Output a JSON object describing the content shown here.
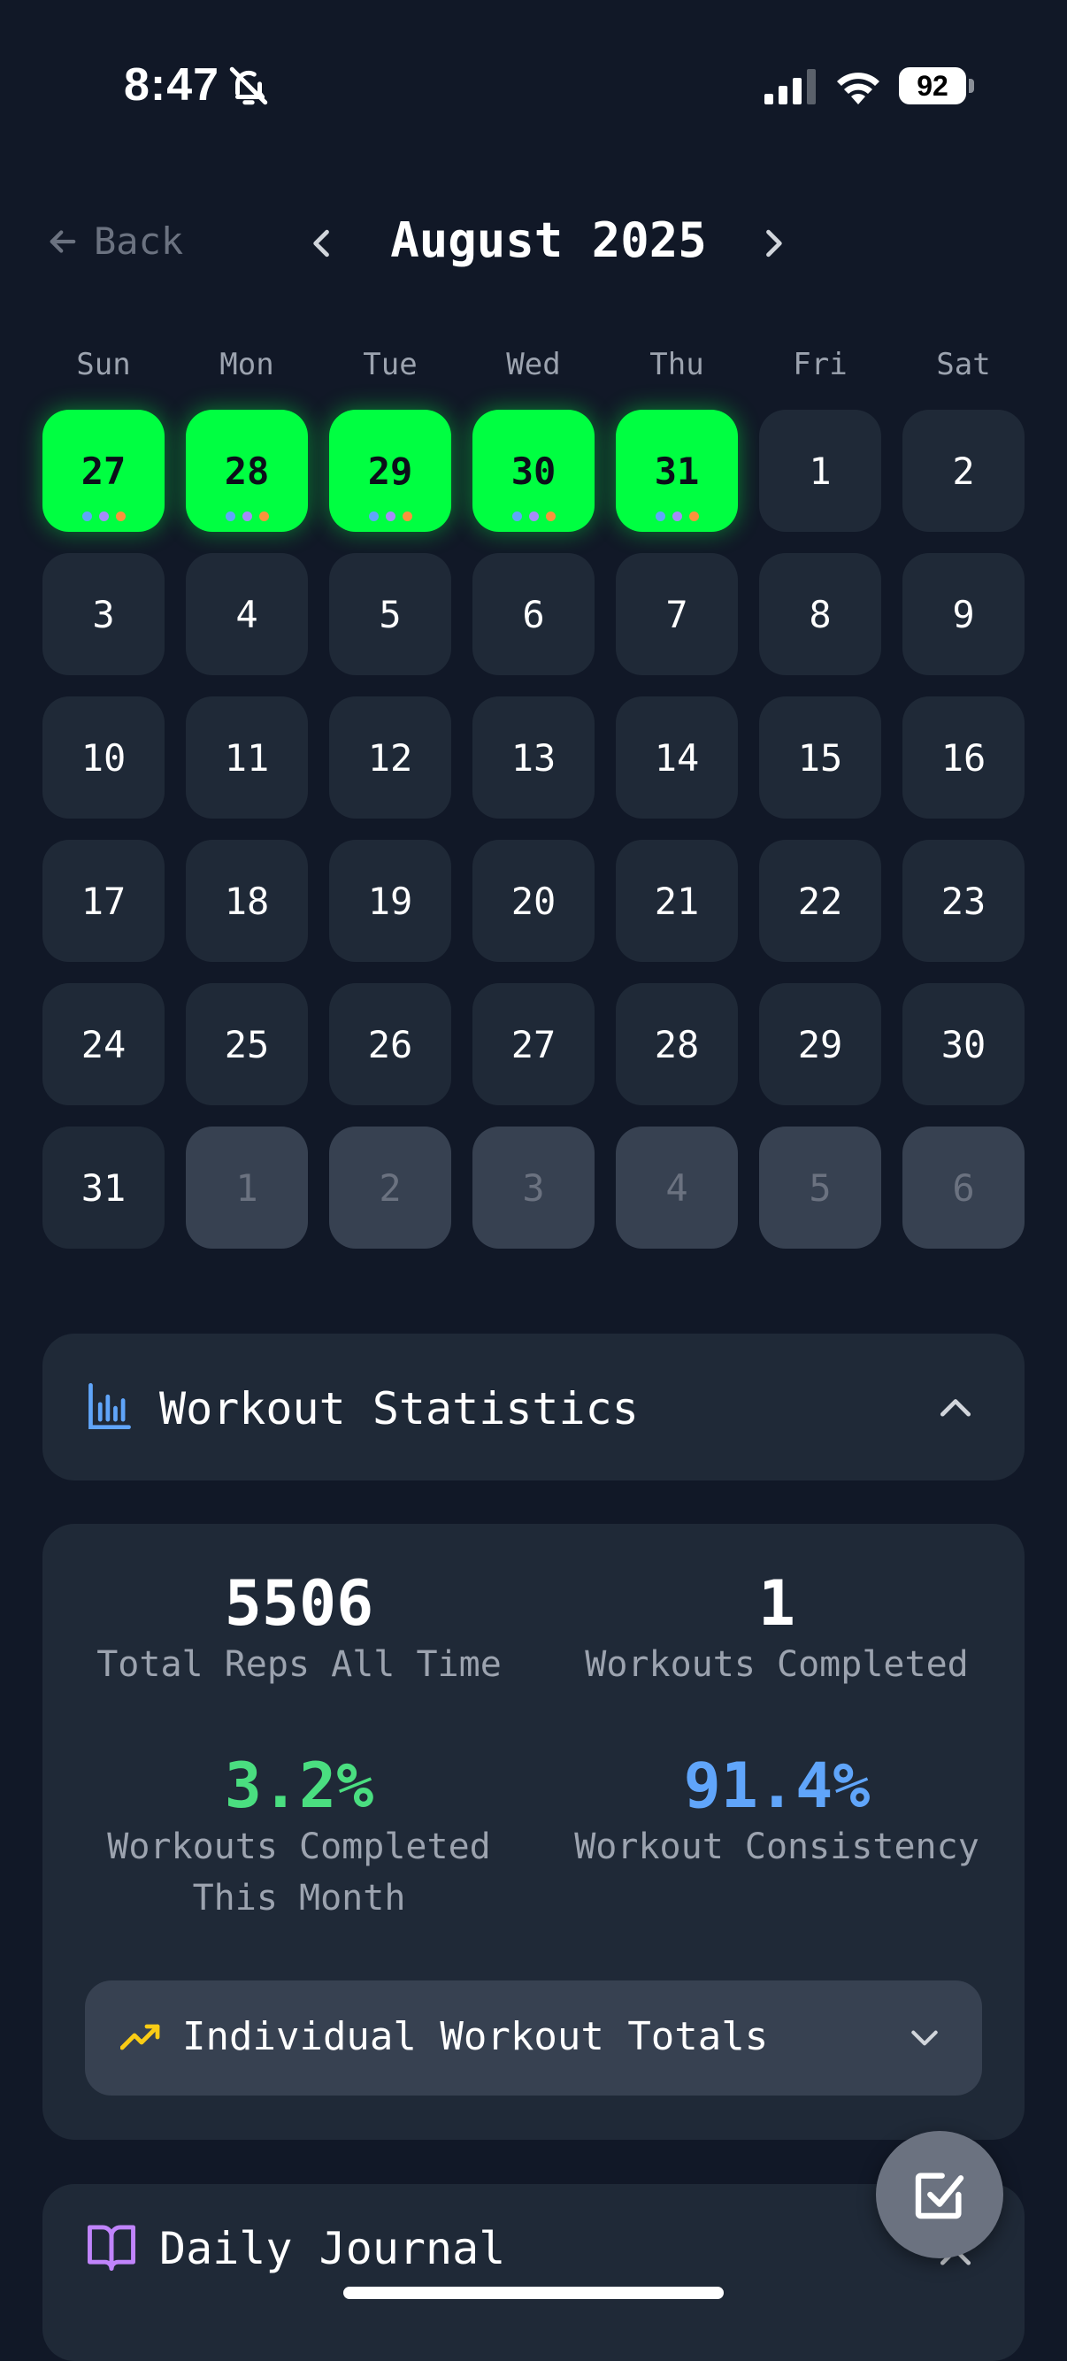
{
  "status_bar": {
    "time": "8:47",
    "battery": "92"
  },
  "nav": {
    "back_label": "Back",
    "month_title": "August 2025"
  },
  "calendar": {
    "weekdays": [
      "Sun",
      "Mon",
      "Tue",
      "Wed",
      "Thu",
      "Fri",
      "Sat"
    ],
    "weeks": [
      [
        {
          "d": "27",
          "s": "done"
        },
        {
          "d": "28",
          "s": "done"
        },
        {
          "d": "29",
          "s": "done"
        },
        {
          "d": "30",
          "s": "done"
        },
        {
          "d": "31",
          "s": "done"
        },
        {
          "d": "1",
          "s": "normal"
        },
        {
          "d": "2",
          "s": "normal"
        }
      ],
      [
        {
          "d": "3",
          "s": "normal"
        },
        {
          "d": "4",
          "s": "normal"
        },
        {
          "d": "5",
          "s": "normal"
        },
        {
          "d": "6",
          "s": "normal"
        },
        {
          "d": "7",
          "s": "normal"
        },
        {
          "d": "8",
          "s": "normal"
        },
        {
          "d": "9",
          "s": "normal"
        }
      ],
      [
        {
          "d": "10",
          "s": "normal"
        },
        {
          "d": "11",
          "s": "normal"
        },
        {
          "d": "12",
          "s": "normal"
        },
        {
          "d": "13",
          "s": "normal"
        },
        {
          "d": "14",
          "s": "normal"
        },
        {
          "d": "15",
          "s": "normal"
        },
        {
          "d": "16",
          "s": "normal"
        }
      ],
      [
        {
          "d": "17",
          "s": "normal"
        },
        {
          "d": "18",
          "s": "normal"
        },
        {
          "d": "19",
          "s": "normal"
        },
        {
          "d": "20",
          "s": "normal"
        },
        {
          "d": "21",
          "s": "normal"
        },
        {
          "d": "22",
          "s": "normal"
        },
        {
          "d": "23",
          "s": "normal"
        }
      ],
      [
        {
          "d": "24",
          "s": "normal"
        },
        {
          "d": "25",
          "s": "normal"
        },
        {
          "d": "26",
          "s": "normal"
        },
        {
          "d": "27",
          "s": "normal"
        },
        {
          "d": "28",
          "s": "normal"
        },
        {
          "d": "29",
          "s": "normal"
        },
        {
          "d": "30",
          "s": "normal"
        }
      ],
      [
        {
          "d": "31",
          "s": "normal"
        },
        {
          "d": "1",
          "s": "other"
        },
        {
          "d": "2",
          "s": "other"
        },
        {
          "d": "3",
          "s": "other"
        },
        {
          "d": "4",
          "s": "other"
        },
        {
          "d": "5",
          "s": "other"
        },
        {
          "d": "6",
          "s": "other"
        }
      ]
    ],
    "dot_colors": [
      "#60a5fa",
      "#a78bfa",
      "#fb923c"
    ]
  },
  "stats": {
    "header_title": "Workout Statistics",
    "total_reps": {
      "value": "5506",
      "label": "Total Reps All Time"
    },
    "workouts_completed": {
      "value": "1",
      "label": "Workouts Completed"
    },
    "monthly_pct": {
      "value": "3.2%",
      "label_line1": "Workouts Completed",
      "label_line2": "This Month"
    },
    "consistency": {
      "value": "91.4%",
      "label": "Workout Consistency"
    },
    "individual_totals_label": "Individual Workout Totals"
  },
  "journal": {
    "title": "Daily Journal"
  },
  "colors": {
    "bg": "#111827",
    "card": "#1f2937",
    "done_green": "#00ff41",
    "stat_green": "#4ade80",
    "stat_blue": "#60a5fa",
    "accent_yellow": "#facc15",
    "journal_purple": "#c084fc"
  }
}
